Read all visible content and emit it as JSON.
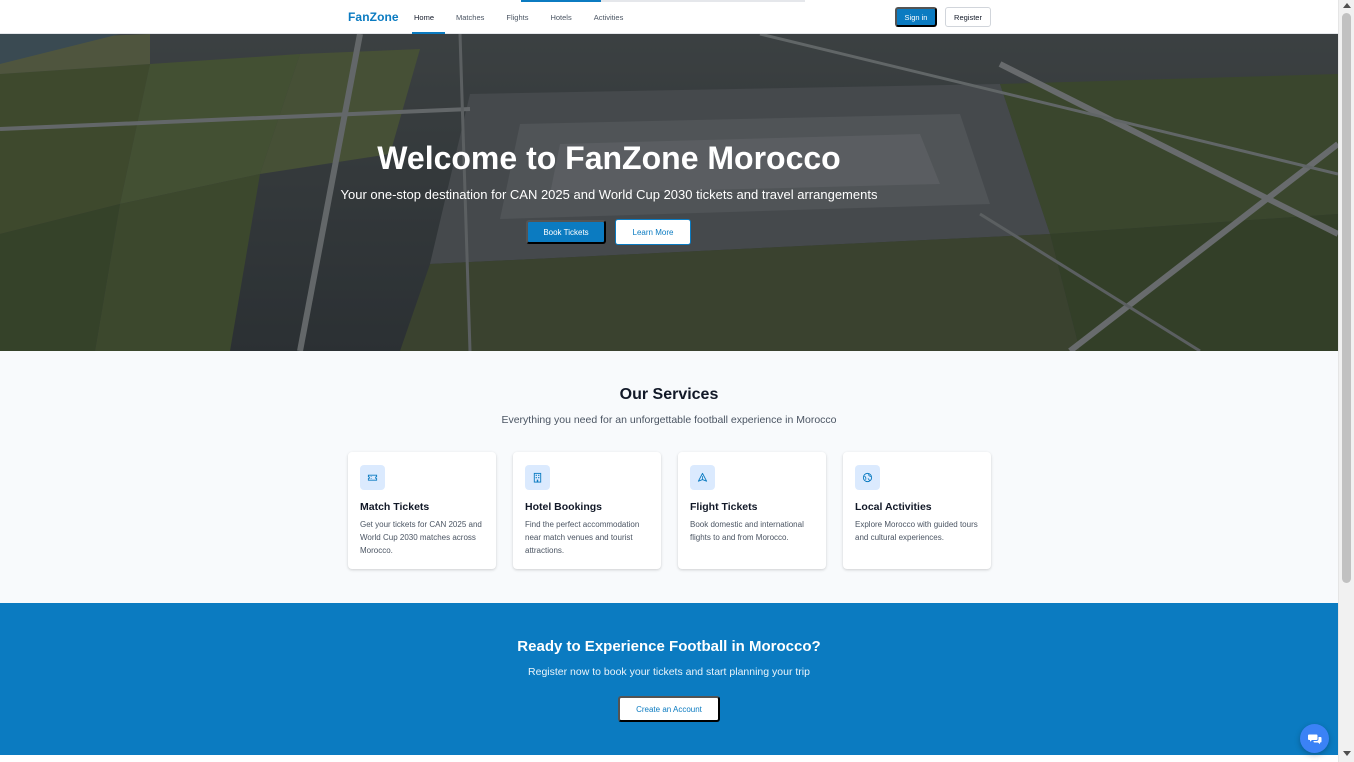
{
  "navbar": {
    "brand": "FanZone",
    "links": [
      "Home",
      "Matches",
      "Flights",
      "Hotels",
      "Activities"
    ],
    "active_link": "Home",
    "signin_label": "Sign in",
    "register_label": "Register",
    "loading_progress": 0.28
  },
  "hero": {
    "title": "Welcome to FanZone Morocco",
    "subtitle": "Your one-stop destination for CAN 2025 and World Cup 2030 tickets and travel arrangements",
    "primary_button": "Book Tickets",
    "secondary_button": "Learn More",
    "background": "aerial-airport-photo"
  },
  "services": {
    "title": "Our Services",
    "subtitle": "Everything you need for an unforgettable football experience in Morocco",
    "cards": [
      {
        "icon": "ticket-icon",
        "title": "Match Tickets",
        "description": "Get your tickets for CAN 2025 and World Cup 2030 matches across Morocco."
      },
      {
        "icon": "building-icon",
        "title": "Hotel Bookings",
        "description": "Find the perfect accommodation near match venues and tourist attractions."
      },
      {
        "icon": "plane-icon",
        "title": "Flight Tickets",
        "description": "Book domestic and international flights to and from Morocco."
      },
      {
        "icon": "globe-icon",
        "title": "Local Activities",
        "description": "Explore Morocco with guided tours and cultural experiences."
      }
    ]
  },
  "cta": {
    "title": "Ready to Experience Football in Morocco?",
    "subtitle": "Register now to book your tickets and start planning your trip",
    "button": "Create an Account"
  },
  "chat": {
    "icon": "chat-bubbles-icon"
  },
  "colors": {
    "primary": "#0b7bc1",
    "icon_bg": "#dbeafe",
    "chat": "#3b82f6",
    "section_bg": "#f8fafc"
  }
}
